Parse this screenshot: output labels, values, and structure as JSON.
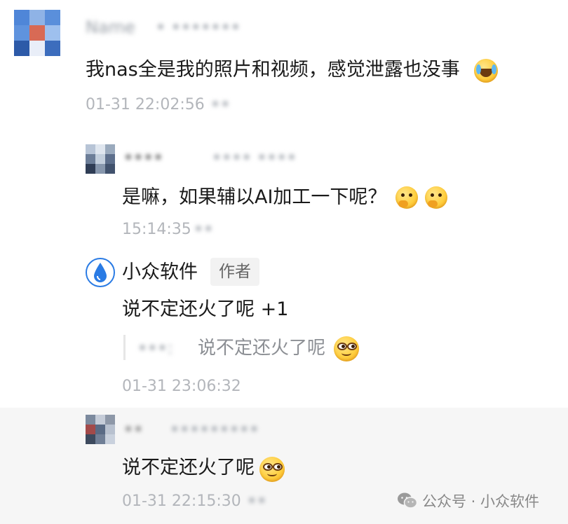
{
  "comments": [
    {
      "user_blur": "Name",
      "meta_blur": "• •••••••",
      "text": "我nas全是我的照片和视频，感觉泄露也没事",
      "emoji": "laugh-cry-emoji",
      "time": "01-31 22:02:56",
      "time_blur": "••"
    },
    {
      "user_blur": "••••",
      "meta_blur": "•••• ••••",
      "text": "是嘛，如果辅以AI加工一下呢？",
      "emoji": "thinking-emoji",
      "time": "15:14:35",
      "time_blur": "••"
    },
    {
      "user": "小众软件",
      "badge": "作者",
      "text": "说不定还火了呢 +1",
      "quote_blur": "•••:",
      "quote_text": "说不定还火了呢",
      "emoji": "smirk-emoji",
      "time": "01-31 23:06:32"
    },
    {
      "user_blur": "••",
      "meta_blur": "•••••••••",
      "text": "说不定还火了呢",
      "emoji": "smirk-emoji",
      "time": "01-31 22:15:30",
      "time_blur": "••"
    }
  ],
  "footer": {
    "text": "公众号 · 小众软件",
    "icon": "wechat-icon"
  },
  "colors": {
    "text": "#1a1a1a",
    "time": "#b3b6bb",
    "author_avatar": "#2a7be4",
    "band": "#f6f6f6"
  }
}
